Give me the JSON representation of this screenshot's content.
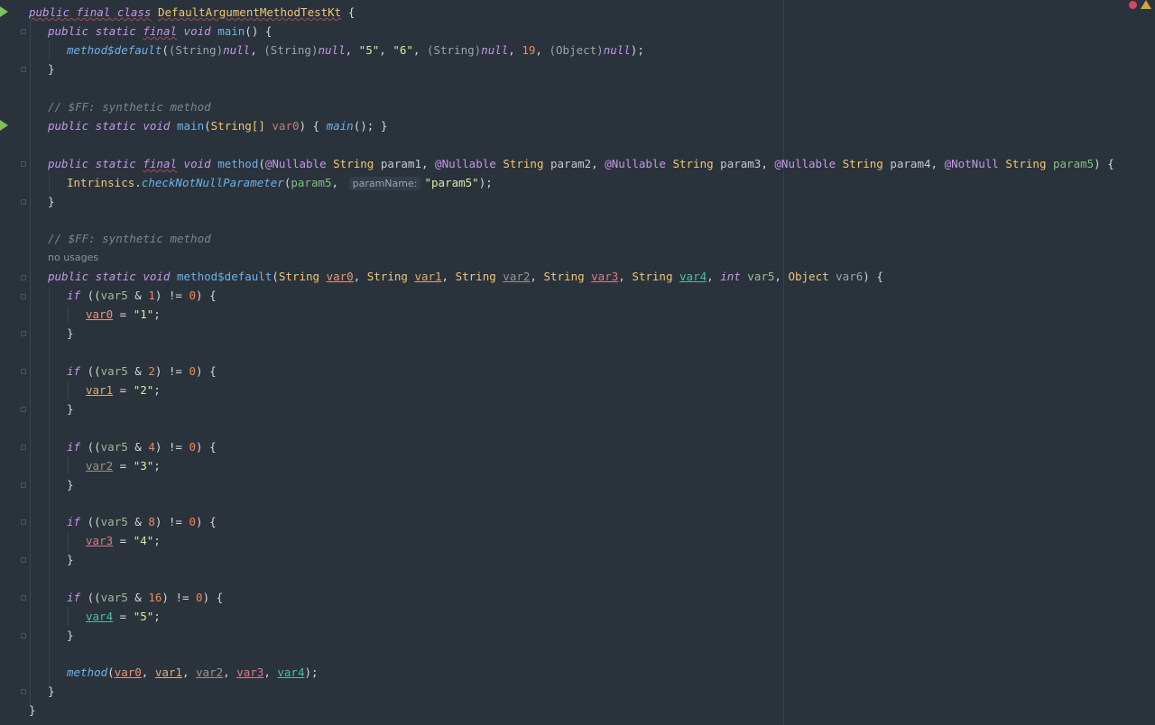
{
  "status": {
    "error_icon": "error-dot-icon",
    "warning_icon": "warning-triangle-icon"
  },
  "code": {
    "class_decl": {
      "kw": "public final class",
      "name": "DefaultArgumentMethodTestKt",
      "brace": " {"
    },
    "main1": {
      "kw1": "public static",
      "kw2": "final",
      "kw3": "void",
      "name": "main",
      "rest": "() {",
      "call_name": "method$default",
      "call_args": [
        "(String)",
        "null",
        "(String)",
        "null",
        "\"5\"",
        "\"6\"",
        "(String)",
        "null",
        "19",
        "(Object)",
        "null"
      ]
    },
    "comment": "// $FF: synthetic method",
    "main2": {
      "kw": "public static void",
      "name": "main",
      "p_type": "String[]",
      "p_name": "var0",
      "inner": "main",
      "tail": "(); }"
    },
    "method": {
      "kw1": "public static",
      "kw2": "final",
      "kw3": "void",
      "name": "method",
      "ann_nullable": "@Nullable",
      "ann_notnull": "@NotNull",
      "type": "String",
      "p1": "param1",
      "p2": "param2",
      "p3": "param3",
      "p4": "param4",
      "p5": "param5",
      "check_cls": "Intrinsics",
      "check_fn": "checkNotNullParameter",
      "inlay": "paramName:",
      "check_str": "\"param5\""
    },
    "no_usages": "no usages",
    "default_method": {
      "kw": "public static void",
      "name": "method$default",
      "type": "String",
      "int_kw": "int",
      "obj_type": "Object",
      "v0": "var0",
      "v1": "var1",
      "v2": "var2",
      "v3": "var3",
      "v4": "var4",
      "v5": "var5",
      "v6": "var6"
    },
    "ifs": [
      {
        "mask": "1",
        "var": "var0",
        "val": "\"1\""
      },
      {
        "mask": "2",
        "var": "var1",
        "val": "\"2\""
      },
      {
        "mask": "4",
        "var": "var2",
        "val": "\"3\""
      },
      {
        "mask": "8",
        "var": "var3",
        "val": "\"4\""
      },
      {
        "mask": "16",
        "var": "var4",
        "val": "\"5\""
      }
    ],
    "if_kw": "if",
    "final_call": "method",
    "zero": "0"
  },
  "colors": {
    "background": "#2a333c",
    "run_marker": "#7cc15a",
    "error": "#d8475d",
    "warning": "#d6a23a"
  }
}
